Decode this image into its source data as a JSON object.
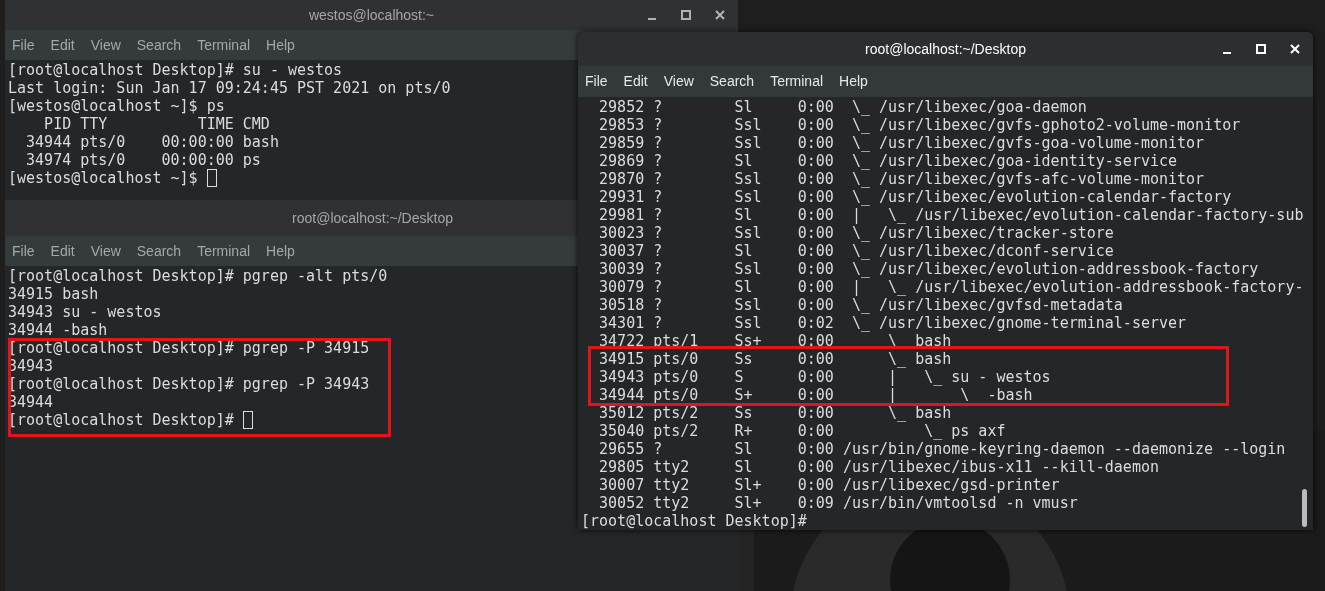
{
  "windows": [
    {
      "title": "westos@localhost:~",
      "active": false,
      "cursor": true,
      "menu": [
        "File",
        "Edit",
        "View",
        "Search",
        "Terminal",
        "Help"
      ],
      "lines": [
        "[root@localhost Desktop]# su - westos",
        "Last login: Sun Jan 17 09:24:45 PST 2021 on pts/0",
        "[westos@localhost ~]$ ps",
        "    PID TTY          TIME CMD",
        "  34944 pts/0    00:00:00 bash",
        "  34974 pts/0    00:00:00 ps",
        "[westos@localhost ~]$ "
      ]
    },
    {
      "title": "root@localhost:~/Desktop",
      "active": false,
      "cursor": true,
      "menu": [
        "File",
        "Edit",
        "View",
        "Search",
        "Terminal",
        "Help"
      ],
      "lines": [
        "[root@localhost Desktop]# pgrep -alt pts/0",
        "34915 bash",
        "34943 su - westos",
        "34944 -bash",
        "[root@localhost Desktop]# pgrep -P 34915",
        "34943",
        "[root@localhost Desktop]# pgrep -P 34943",
        "34944",
        "[root@localhost Desktop]# "
      ]
    },
    {
      "title": "root@localhost:~/Desktop",
      "active": true,
      "cursor": false,
      "menu": [
        "File",
        "Edit",
        "View",
        "Search",
        "Terminal",
        "Help"
      ],
      "lines": [
        "  29852 ?        Sl     0:00  \\_ /usr/libexec/goa-daemon",
        "  29853 ?        Ssl    0:00  \\_ /usr/libexec/gvfs-gphoto2-volume-monitor",
        "  29859 ?        Ssl    0:00  \\_ /usr/libexec/gvfs-goa-volume-monitor",
        "  29869 ?        Sl     0:00  \\_ /usr/libexec/goa-identity-service",
        "  29870 ?        Ssl    0:00  \\_ /usr/libexec/gvfs-afc-volume-monitor",
        "  29931 ?        Ssl    0:00  \\_ /usr/libexec/evolution-calendar-factory",
        "  29981 ?        Sl     0:00  |   \\_ /usr/libexec/evolution-calendar-factory-sub",
        "  30023 ?        Ssl    0:00  \\_ /usr/libexec/tracker-store",
        "  30037 ?        Sl     0:00  \\_ /usr/libexec/dconf-service",
        "  30039 ?        Ssl    0:00  \\_ /usr/libexec/evolution-addressbook-factory",
        "  30079 ?        Sl     0:00  |   \\_ /usr/libexec/evolution-addressbook-factory-",
        "  30518 ?        Ssl    0:00  \\_ /usr/libexec/gvfsd-metadata",
        "  34301 ?        Ssl    0:02  \\_ /usr/libexec/gnome-terminal-server",
        "  34722 pts/1    Ss+    0:00      \\  bash",
        "  34915 pts/0    Ss     0:00      \\_ bash",
        "  34943 pts/0    S      0:00      |   \\_ su - westos",
        "  34944 pts/0    S+     0:00      |       \\  -bash",
        "  35012 pts/2    Ss     0:00      \\_ bash",
        "  35040 pts/2    R+     0:00          \\_ ps axf",
        "  29655 ?        Sl     0:00 /usr/bin/gnome-keyring-daemon --daemonize --login",
        "  29805 tty2     Sl     0:00 /usr/libexec/ibus-x11 --kill-daemon",
        "  30007 tty2     Sl+    0:00 /usr/libexec/gsd-printer",
        "  30052 tty2     Sl+    0:09 /usr/bin/vmtoolsd -n vmusr",
        "[root@localhost Desktop]#"
      ]
    }
  ]
}
